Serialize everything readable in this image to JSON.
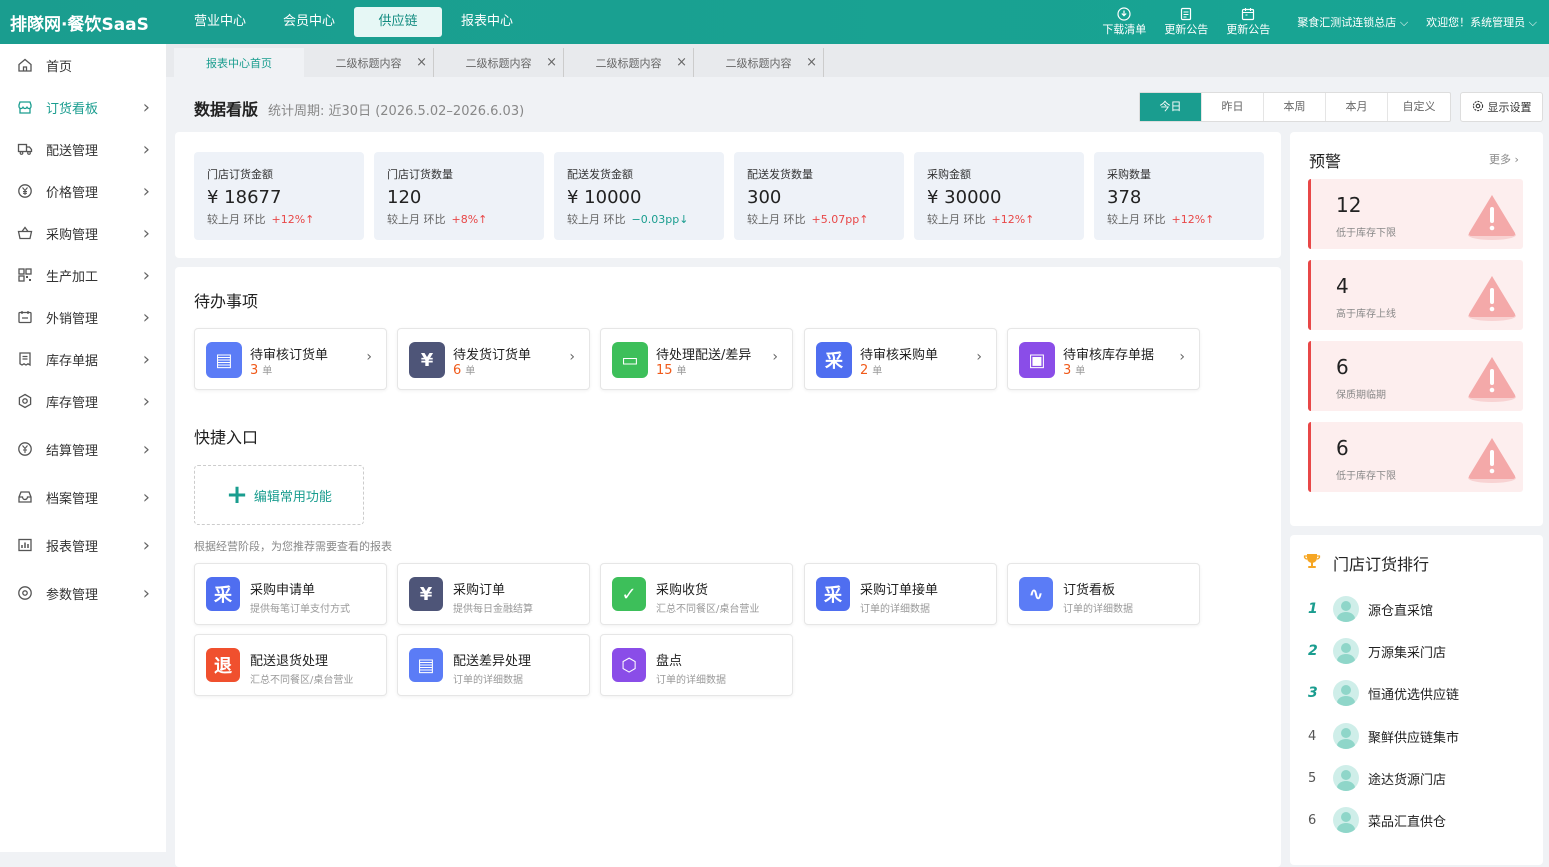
{
  "topbar": {
    "logo": "排隊网·餐饮SaaS",
    "nav": [
      {
        "label": "营业中心",
        "active": false
      },
      {
        "label": "会员中心",
        "active": false
      },
      {
        "label": "供应链",
        "active": true
      },
      {
        "label": "报表中心",
        "active": false
      }
    ],
    "actions": [
      {
        "label": "下载清单",
        "icon": "download-icon"
      },
      {
        "label": "更新公告",
        "icon": "document-icon"
      },
      {
        "label": "更新公告",
        "icon": "calendar-icon"
      }
    ],
    "org_select": "聚食汇测试连锁总店",
    "welcome": "欢迎您！系统管理员"
  },
  "sidebar": {
    "items": [
      {
        "label": "首页",
        "icon": "home-icon",
        "active": false,
        "has_chevron": false
      },
      {
        "label": "订货看板",
        "icon": "store-icon",
        "active": true,
        "has_chevron": true
      },
      {
        "label": "配送管理",
        "icon": "truck-icon",
        "active": false,
        "has_chevron": true
      },
      {
        "label": "价格管理",
        "icon": "yen-icon",
        "active": false,
        "has_chevron": true
      },
      {
        "label": "采购管理",
        "icon": "basket-icon",
        "active": false,
        "has_chevron": true
      },
      {
        "label": "生产加工",
        "icon": "grid-icon",
        "active": false,
        "has_chevron": true
      },
      {
        "label": "外销管理",
        "icon": "calendar-icon",
        "active": false,
        "has_chevron": true
      },
      {
        "label": "库存单据",
        "icon": "receipt-icon",
        "active": false,
        "has_chevron": true
      },
      {
        "label": "库存管理",
        "icon": "hexagon-icon",
        "active": false,
        "has_chevron": true
      },
      {
        "label": "结算管理",
        "icon": "coin-icon",
        "active": false,
        "has_chevron": true
      },
      {
        "label": "档案管理",
        "icon": "inbox-icon",
        "active": false,
        "has_chevron": true
      },
      {
        "label": "报表管理",
        "icon": "bar-chart-icon",
        "active": false,
        "has_chevron": true
      },
      {
        "label": "参数管理",
        "icon": "settings-icon",
        "active": false,
        "has_chevron": true
      }
    ]
  },
  "tabs": [
    {
      "label": "报表中心首页",
      "active": true
    },
    {
      "label": "二级标题内容",
      "active": false
    },
    {
      "label": "二级标题内容",
      "active": false
    },
    {
      "label": "二级标题内容",
      "active": false
    },
    {
      "label": "二级标题内容",
      "active": false
    }
  ],
  "dashboard": {
    "title": "数据看版",
    "period": "统计周期: 近30日 (2026.5.02–2026.6.03)",
    "ranges": [
      "今日",
      "昨日",
      "本周",
      "本月",
      "自定义"
    ],
    "active_range": "今日",
    "display_settings": "显示设置"
  },
  "metrics": [
    {
      "label": "门店订货金额",
      "value": "¥ 18677",
      "compare": "较上月 环比",
      "change": "+12%",
      "dir": "up",
      "arrow": "↑"
    },
    {
      "label": "门店订货数量",
      "value": "120",
      "compare": "较上月 环比",
      "change": "+8%",
      "dir": "up",
      "arrow": "↑"
    },
    {
      "label": "配送发货金额",
      "value": "¥ 10000",
      "compare": "较上月 环比",
      "change": "−0.03pp",
      "dir": "down",
      "arrow": "↓"
    },
    {
      "label": "配送发货数量",
      "value": "300",
      "compare": "较上月 环比",
      "change": "+5.07pp",
      "dir": "up",
      "arrow": "↑"
    },
    {
      "label": "采购金额",
      "value": "¥ 30000",
      "compare": "较上月 环比",
      "change": "+12%",
      "dir": "up",
      "arrow": "↑"
    },
    {
      "label": "采购数量",
      "value": "378",
      "compare": "较上月 环比",
      "change": "+12%",
      "dir": "up",
      "arrow": "↑"
    }
  ],
  "todo": {
    "title": "待办事项",
    "items": [
      {
        "label": "待审核订货单",
        "count": "3",
        "unit": "单",
        "icon": "order-review-icon",
        "glyph": "▤",
        "color": "#5b7cf6"
      },
      {
        "label": "待发货订货单",
        "count": "6",
        "unit": "单",
        "icon": "shipping-box-icon",
        "glyph": "¥",
        "color": "#4e5578"
      },
      {
        "label": "待处理配送/差异",
        "count": "15",
        "unit": "单",
        "icon": "delivery-diff-icon",
        "glyph": "▭",
        "color": "#3dbf5a"
      },
      {
        "label": "待审核采购单",
        "count": "2",
        "unit": "单",
        "icon": "purchase-review-icon",
        "glyph": "采",
        "color": "#4f6ef0"
      },
      {
        "label": "待审核库存单据",
        "count": "3",
        "unit": "单",
        "icon": "inventory-doc-icon",
        "glyph": "▣",
        "color": "#8a4de8"
      }
    ]
  },
  "quick": {
    "title": "快捷入口",
    "edit_label": "编辑常用功能",
    "hint": "根据经营阶段，为您推荐需要查看的报表",
    "items": [
      {
        "label": "采购申请单",
        "sub": "提供每笔订单支付方式",
        "icon": "purchase-request-icon",
        "glyph": "采",
        "color": "#4f6ef0"
      },
      {
        "label": "采购订单",
        "sub": "提供每日金融结算",
        "icon": "purchase-order-icon",
        "glyph": "¥",
        "color": "#4e5578"
      },
      {
        "label": "采购收货",
        "sub": "汇总不同餐区/桌台营业",
        "icon": "purchase-receive-icon",
        "glyph": "✓",
        "color": "#3dbf5a"
      },
      {
        "label": "采购订单接单",
        "sub": "订单的详细数据",
        "icon": "order-accept-icon",
        "glyph": "采",
        "color": "#4f6ef0"
      },
      {
        "label": "订货看板",
        "sub": "订单的详细数据",
        "icon": "order-board-icon",
        "glyph": "∿",
        "color": "#5b7cf6"
      },
      {
        "label": "配送退货处理",
        "sub": "汇总不同餐区/桌台营业",
        "icon": "return-icon",
        "glyph": "退",
        "color": "#f0502e"
      },
      {
        "label": "配送差异处理",
        "sub": "订单的详细数据",
        "icon": "delivery-diff-icon",
        "glyph": "▤",
        "color": "#5b7cf6"
      },
      {
        "label": "盘点",
        "sub": "订单的详细数据",
        "icon": "stocktake-icon",
        "glyph": "⬡",
        "color": "#8a4de8"
      }
    ]
  },
  "warnings": {
    "title": "预警",
    "more": "更多",
    "items": [
      {
        "count": "12",
        "label": "低于库存下限"
      },
      {
        "count": "4",
        "label": "高于库存上线"
      },
      {
        "count": "6",
        "label": "保质期临期"
      },
      {
        "count": "6",
        "label": "低于库存下限"
      }
    ]
  },
  "ranking": {
    "title": "门店订货排行",
    "items": [
      {
        "rank": "1",
        "name": "源仓直采馆"
      },
      {
        "rank": "2",
        "name": "万源集采门店"
      },
      {
        "rank": "3",
        "name": "恒通优选供应链"
      },
      {
        "rank": "4",
        "name": "聚鲜供应链集市"
      },
      {
        "rank": "5",
        "name": "途达货源门店"
      },
      {
        "rank": "6",
        "name": "菜品汇直供仓"
      }
    ]
  }
}
